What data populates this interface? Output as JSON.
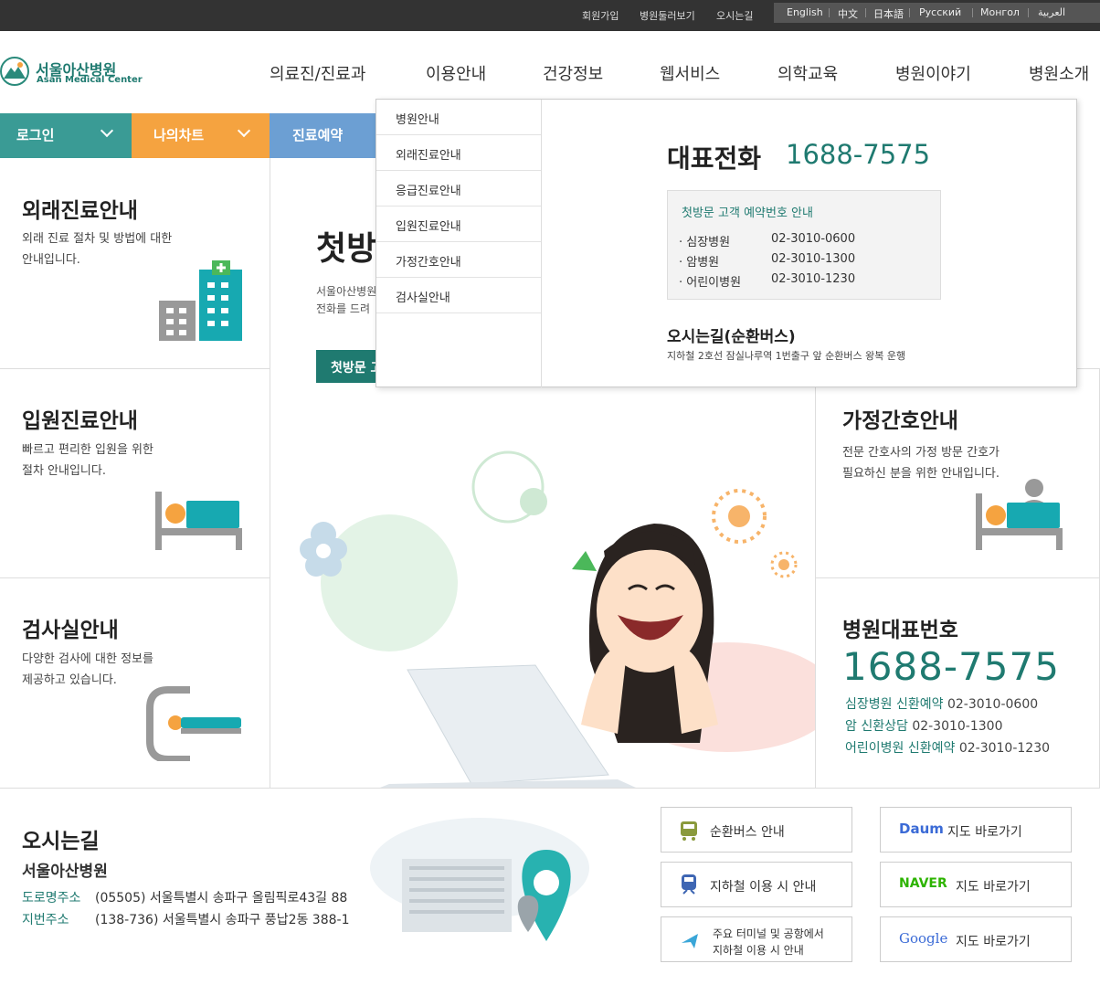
{
  "topbar": {
    "links": [
      "회원가입",
      "병원둘러보기",
      "오시는길"
    ],
    "languages": [
      "English",
      "中文",
      "日本語",
      "Русский",
      "Монгол",
      "العربية"
    ]
  },
  "logo": {
    "name_ko": "서울아산병원",
    "name_en": "Asan Medical Center"
  },
  "gnb": [
    "의료진/진료과",
    "이용안내",
    "건강정보",
    "웹서비스",
    "의학교육",
    "병원이야기",
    "병원소개"
  ],
  "tabs": {
    "login": "로그인",
    "mychart": "나의차트",
    "reservation": "진료예약"
  },
  "dropdown": {
    "menu": [
      "병원안내",
      "외래진료안내",
      "응급진료안내",
      "입원진료안내",
      "가정간호안내",
      "검사실안내"
    ],
    "rep_phone_label": "대표전화",
    "rep_phone": "1688-7575",
    "box_title": "첫방문 고객 예약번호 안내",
    "box_rows": [
      {
        "name": "· 심장병원",
        "phone": "02-3010-0600"
      },
      {
        "name": "· 암병원",
        "phone": "02-3010-1300"
      },
      {
        "name": "· 어린이병원",
        "phone": "02-3010-1230"
      }
    ],
    "directions_title": "오시는길(순환버스)",
    "directions_text": "지하철 2호선 잠실나루역 1번출구 앞 순환버스 왕복 운행"
  },
  "left_cards": [
    {
      "title": "외래진료안내",
      "desc1": "외래 진료 절차 및 방법에 대한",
      "desc2": "안내입니다."
    },
    {
      "title": "입원진료안내",
      "desc1": "빠르고 편리한 입원을 위한",
      "desc2": "절차 안내입니다."
    },
    {
      "title": "검사실안내",
      "desc1": "다양한 검사에 대한 정보를",
      "desc2": "제공하고 있습니다."
    }
  ],
  "center": {
    "title_partial": "첫방",
    "text1_partial": "서울아산병원",
    "text2_partial": "전화를 드려",
    "button_partial": "첫방문 고"
  },
  "right_cards": {
    "home_title": "가정간호안내",
    "home_desc1": "전문 간호사의 가정 방문 간호가",
    "home_desc2": "필요하신 분을 위한 안내입니다.",
    "rep_title": "병원대표번호",
    "rep_number": "1688-7575",
    "rep_rows": [
      {
        "label": "심장병원 신환예약",
        "phone": "02-3010-0600"
      },
      {
        "label": "암 신환상담",
        "phone": "02-3010-1300"
      },
      {
        "label": "어린이병원 신환예약",
        "phone": "02-3010-1230"
      }
    ]
  },
  "directions": {
    "title": "오시는길",
    "hospital": "서울아산병원",
    "road_label": "도로명주소",
    "road_address": "(05505) 서울특별시 송파구 올림픽로43길 88",
    "lot_label": "지번주소",
    "lot_address": "(138-736) 서울특별시 송파구 풍납2동 388-1"
  },
  "bottom_buttons": {
    "bus": "순환버스 안내",
    "subway": "지하철 이용 시 안내",
    "terminal1": "주요 터미널 및 공항에서",
    "terminal2": "지하철 이용 시 안내",
    "daum_logo": "Daum",
    "naver_logo": "NAVER",
    "google_logo": "Google",
    "map_shortcut": "지도 바로가기"
  },
  "colors": {
    "teal": "#3a9b95",
    "orange": "#f5a340",
    "blue": "#6c9fd3",
    "dark_teal": "#1f7a70"
  }
}
